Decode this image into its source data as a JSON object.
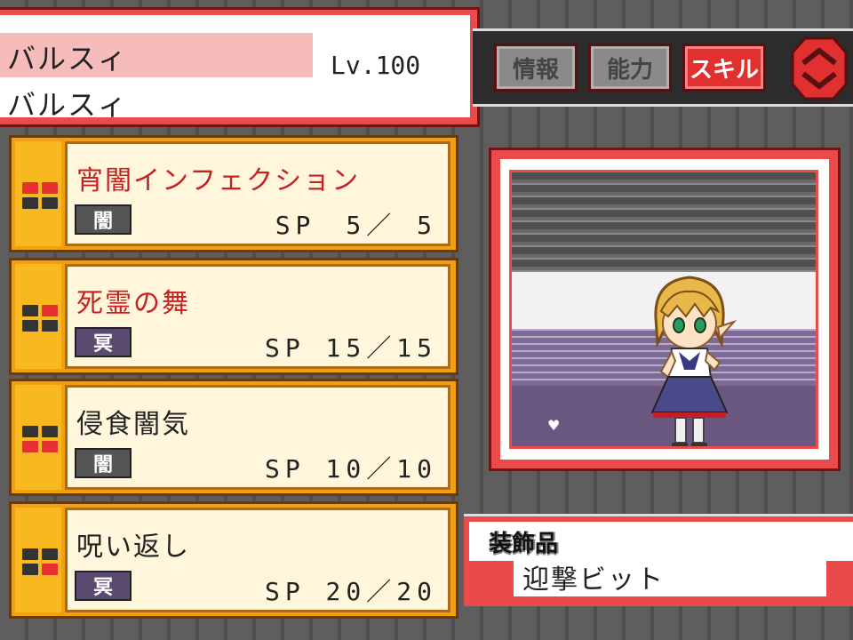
{
  "character": {
    "name_primary": "バルスィ",
    "name_secondary": "バルスィ",
    "level": "Lv.100"
  },
  "tabs": [
    {
      "label": "情報",
      "active": false
    },
    {
      "label": "能力",
      "active": false
    },
    {
      "label": "スキル",
      "active": true
    }
  ],
  "skills": [
    {
      "name": "宵闇インフェクション",
      "name_color": "red",
      "element": "闇",
      "element_color": "dark",
      "sp": "SP　5／ 5",
      "grid": [
        1,
        1,
        0,
        0
      ]
    },
    {
      "name": "死霊の舞",
      "name_color": "red",
      "element": "冥",
      "element_color": "purple",
      "sp": "SP 15／15",
      "grid": [
        0,
        1,
        0,
        0
      ]
    },
    {
      "name": "侵食闇気",
      "name_color": "dark",
      "element": "闇",
      "element_color": "dark",
      "sp": "SP 10／10",
      "grid": [
        0,
        0,
        1,
        1
      ]
    },
    {
      "name": "呪い返し",
      "name_color": "dark",
      "element": "冥",
      "element_color": "purple",
      "sp": "SP 20／20",
      "grid": [
        0,
        0,
        0,
        1
      ]
    }
  ],
  "accessory": {
    "label": "装飾品",
    "value": "迎撃ビット"
  },
  "colors": {
    "accent_red": "#e94a4a",
    "card_orange": "#f0a010",
    "skill_red_text": "#c82020"
  }
}
